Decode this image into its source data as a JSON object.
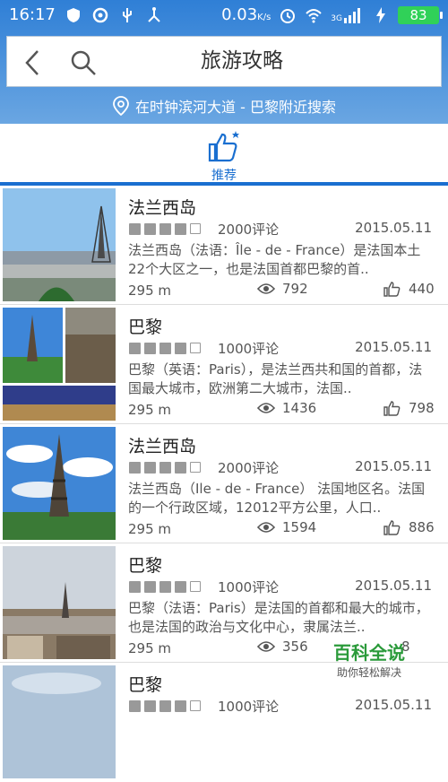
{
  "status_bar": {
    "time": "16:17",
    "speed": "0.03",
    "speed_unit": "K/s",
    "network": "3G",
    "battery": "83"
  },
  "header": {
    "title": "旅游攻略",
    "location_text": "在时钟滨河大道 - 巴黎附近搜索"
  },
  "tabs": [
    {
      "label": "推荐",
      "icon": "thumbs-up-icon",
      "active": true
    }
  ],
  "colors": {
    "primary": "#1a6fd0",
    "star": "#999999",
    "watermark_green": "#2a9a3a"
  },
  "items": [
    {
      "name": "法兰西岛",
      "stars": 4,
      "reviews": "2000评论",
      "date": "2015.05.11",
      "desc": "法兰西岛（法语：Île - de - France）是法国本土22个大区之一，也是法国首都巴黎的首..",
      "distance": "295 m",
      "views": "792",
      "likes": "440"
    },
    {
      "name": "巴黎",
      "stars": 4,
      "reviews": "1000评论",
      "date": "2015.05.11",
      "desc": "巴黎（英语：Paris），是法兰西共和国的首都，法国最大城市，欧洲第二大城市，法国..",
      "distance": "295 m",
      "views": "1436",
      "likes": "798"
    },
    {
      "name": "法兰西岛",
      "stars": 4,
      "reviews": "2000评论",
      "date": "2015.05.11",
      "desc": "法兰西岛（Ile - de - France） 法国地区名。法国的一个行政区域，12012平方公里，人口..",
      "distance": "295 m",
      "views": "1594",
      "likes": "886"
    },
    {
      "name": "巴黎",
      "stars": 4,
      "reviews": "1000评论",
      "date": "2015.05.11",
      "desc": "巴黎（法语：Paris）是法国的首都和最大的城市，也是法国的政治与文化中心，隶属法兰..",
      "distance": "295 m",
      "views": "356",
      "likes": "8"
    },
    {
      "name": "巴黎",
      "stars": 4,
      "reviews": "1000评论",
      "date": "2015.05.11",
      "desc": "",
      "distance": "",
      "views": "",
      "likes": ""
    }
  ],
  "watermark": {
    "main": "百科全说",
    "sub": "助你轻松解决"
  }
}
